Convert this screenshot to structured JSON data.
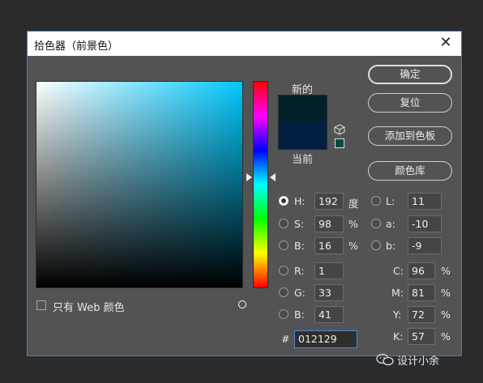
{
  "dialog": {
    "title": "拾色器（前景色）",
    "close_glyph": "✕"
  },
  "preview": {
    "new_label": "新的",
    "current_label": "当前",
    "new_color": "#012129",
    "current_color": "#012041"
  },
  "buttons": {
    "ok": "确定",
    "reset": "复位",
    "add_to_swatches": "添加到色板",
    "color_libraries": "颜色库"
  },
  "hsb": {
    "h": {
      "label": "H:",
      "value": "192",
      "unit": "度",
      "selected": true
    },
    "s": {
      "label": "S:",
      "value": "98",
      "unit": "%"
    },
    "b": {
      "label": "B:",
      "value": "16",
      "unit": "%"
    }
  },
  "rgb": {
    "r": {
      "label": "R:",
      "value": "1"
    },
    "g": {
      "label": "G:",
      "value": "33"
    },
    "b": {
      "label": "B:",
      "value": "41"
    }
  },
  "lab": {
    "l": {
      "label": "L:",
      "value": "11"
    },
    "a": {
      "label": "a:",
      "value": "-10"
    },
    "b": {
      "label": "b:",
      "value": "-9"
    }
  },
  "cmyk": {
    "c": {
      "label": "C:",
      "value": "96",
      "unit": "%"
    },
    "m": {
      "label": "M:",
      "value": "81",
      "unit": "%"
    },
    "y": {
      "label": "Y:",
      "value": "72",
      "unit": "%"
    },
    "k": {
      "label": "K:",
      "value": "57",
      "unit": "%"
    }
  },
  "hex": {
    "label": "#",
    "value": "012129"
  },
  "web_only": {
    "label": "只有 Web 颜色",
    "checked": false
  },
  "watermark": "设计小余"
}
